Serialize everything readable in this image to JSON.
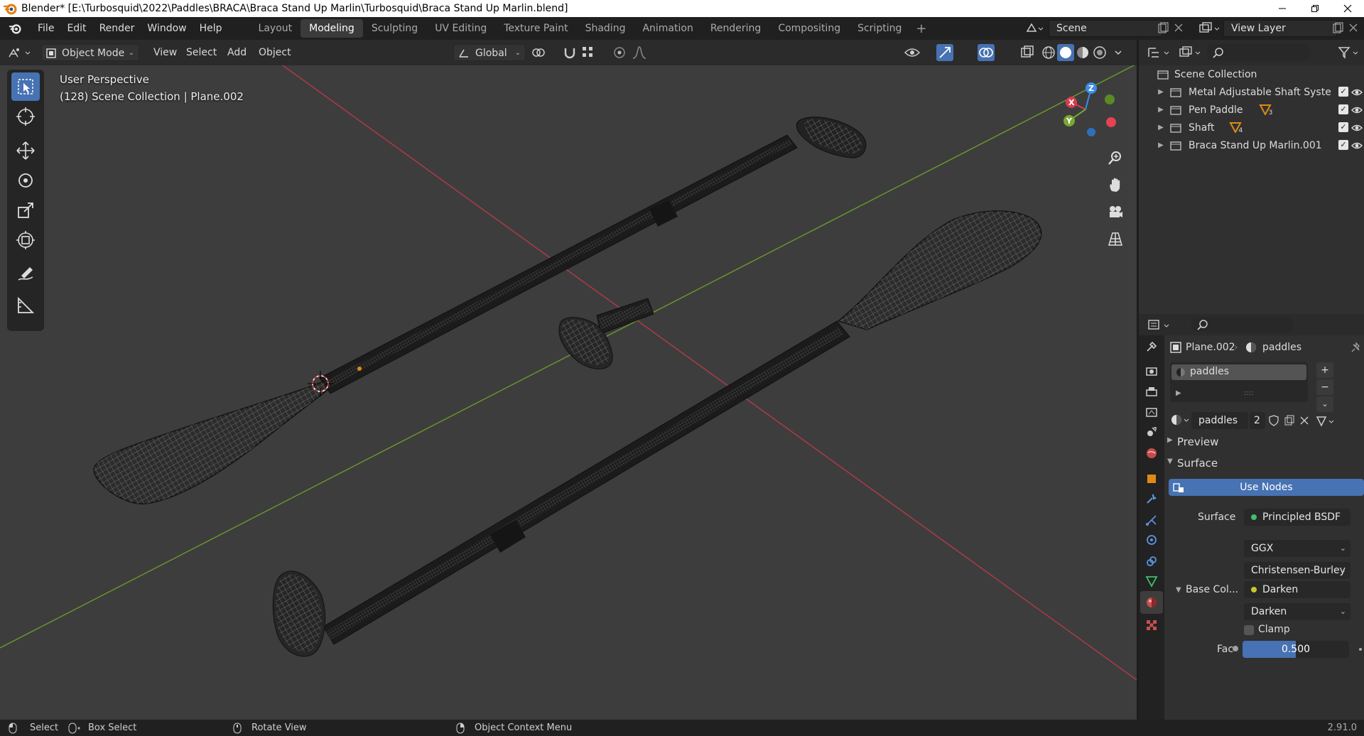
{
  "window": {
    "title": "Blender* [E:\\Turbosquid\\2022\\Paddles\\BRACA\\Braca Stand Up Marlin\\Turbosquid\\Braca Stand Up Marlin.blend]"
  },
  "topbar": {
    "menus": [
      "File",
      "Edit",
      "Render",
      "Window",
      "Help"
    ],
    "workspaces": [
      "Layout",
      "Modeling",
      "Sculpting",
      "UV Editing",
      "Texture Paint",
      "Shading",
      "Animation",
      "Rendering",
      "Compositing",
      "Scripting"
    ],
    "active_workspace": "Modeling",
    "scene": "Scene",
    "view_layer": "View Layer"
  },
  "viewport_header": {
    "mode": "Object Mode",
    "menus": [
      "View",
      "Select",
      "Add",
      "Object"
    ],
    "transform_orientation": "Global"
  },
  "viewport": {
    "overlay_line1": "User Perspective",
    "overlay_line2": "(128) Scene Collection | Plane.002",
    "gizmo": {
      "x": "X",
      "y": "Y",
      "z": "Z"
    }
  },
  "outliner": {
    "root": "Scene Collection",
    "items": [
      {
        "label": "Metal Adjustable Shaft System",
        "count": ""
      },
      {
        "label": "Pen Paddle",
        "count": "3"
      },
      {
        "label": "Shaft",
        "count": "4"
      },
      {
        "label": "Braca Stand Up Marlin.001",
        "count": ""
      }
    ]
  },
  "properties": {
    "object": "Plane.002",
    "material": "paddles",
    "slot": "paddles",
    "material_name": "paddles",
    "users": "2",
    "panel_preview": "Preview",
    "panel_surface": "Surface",
    "use_nodes": "Use Nodes",
    "surface_label": "Surface",
    "surface_value": "Principled BSDF",
    "distribution": "GGX",
    "subsurface_method": "Christensen-Burley",
    "base_color_label": "Base Col...",
    "base_color_value": "Darken",
    "blend_mode": "Darken",
    "clamp_label": "Clamp",
    "fac_label": "Fac",
    "fac_value": "0.500",
    "fac_fraction": 0.5
  },
  "statusbar": {
    "select": "Select",
    "box_select": "Box Select",
    "rotate_view": "Rotate View",
    "context_menu": "Object Context Menu",
    "version": "2.91.0"
  },
  "colors": {
    "accent": "#4772b3",
    "x_axis": "#d63d4f",
    "y_axis": "#7aa832",
    "z_axis": "#3a8de8",
    "viewport_bg": "#3d3d3d"
  }
}
